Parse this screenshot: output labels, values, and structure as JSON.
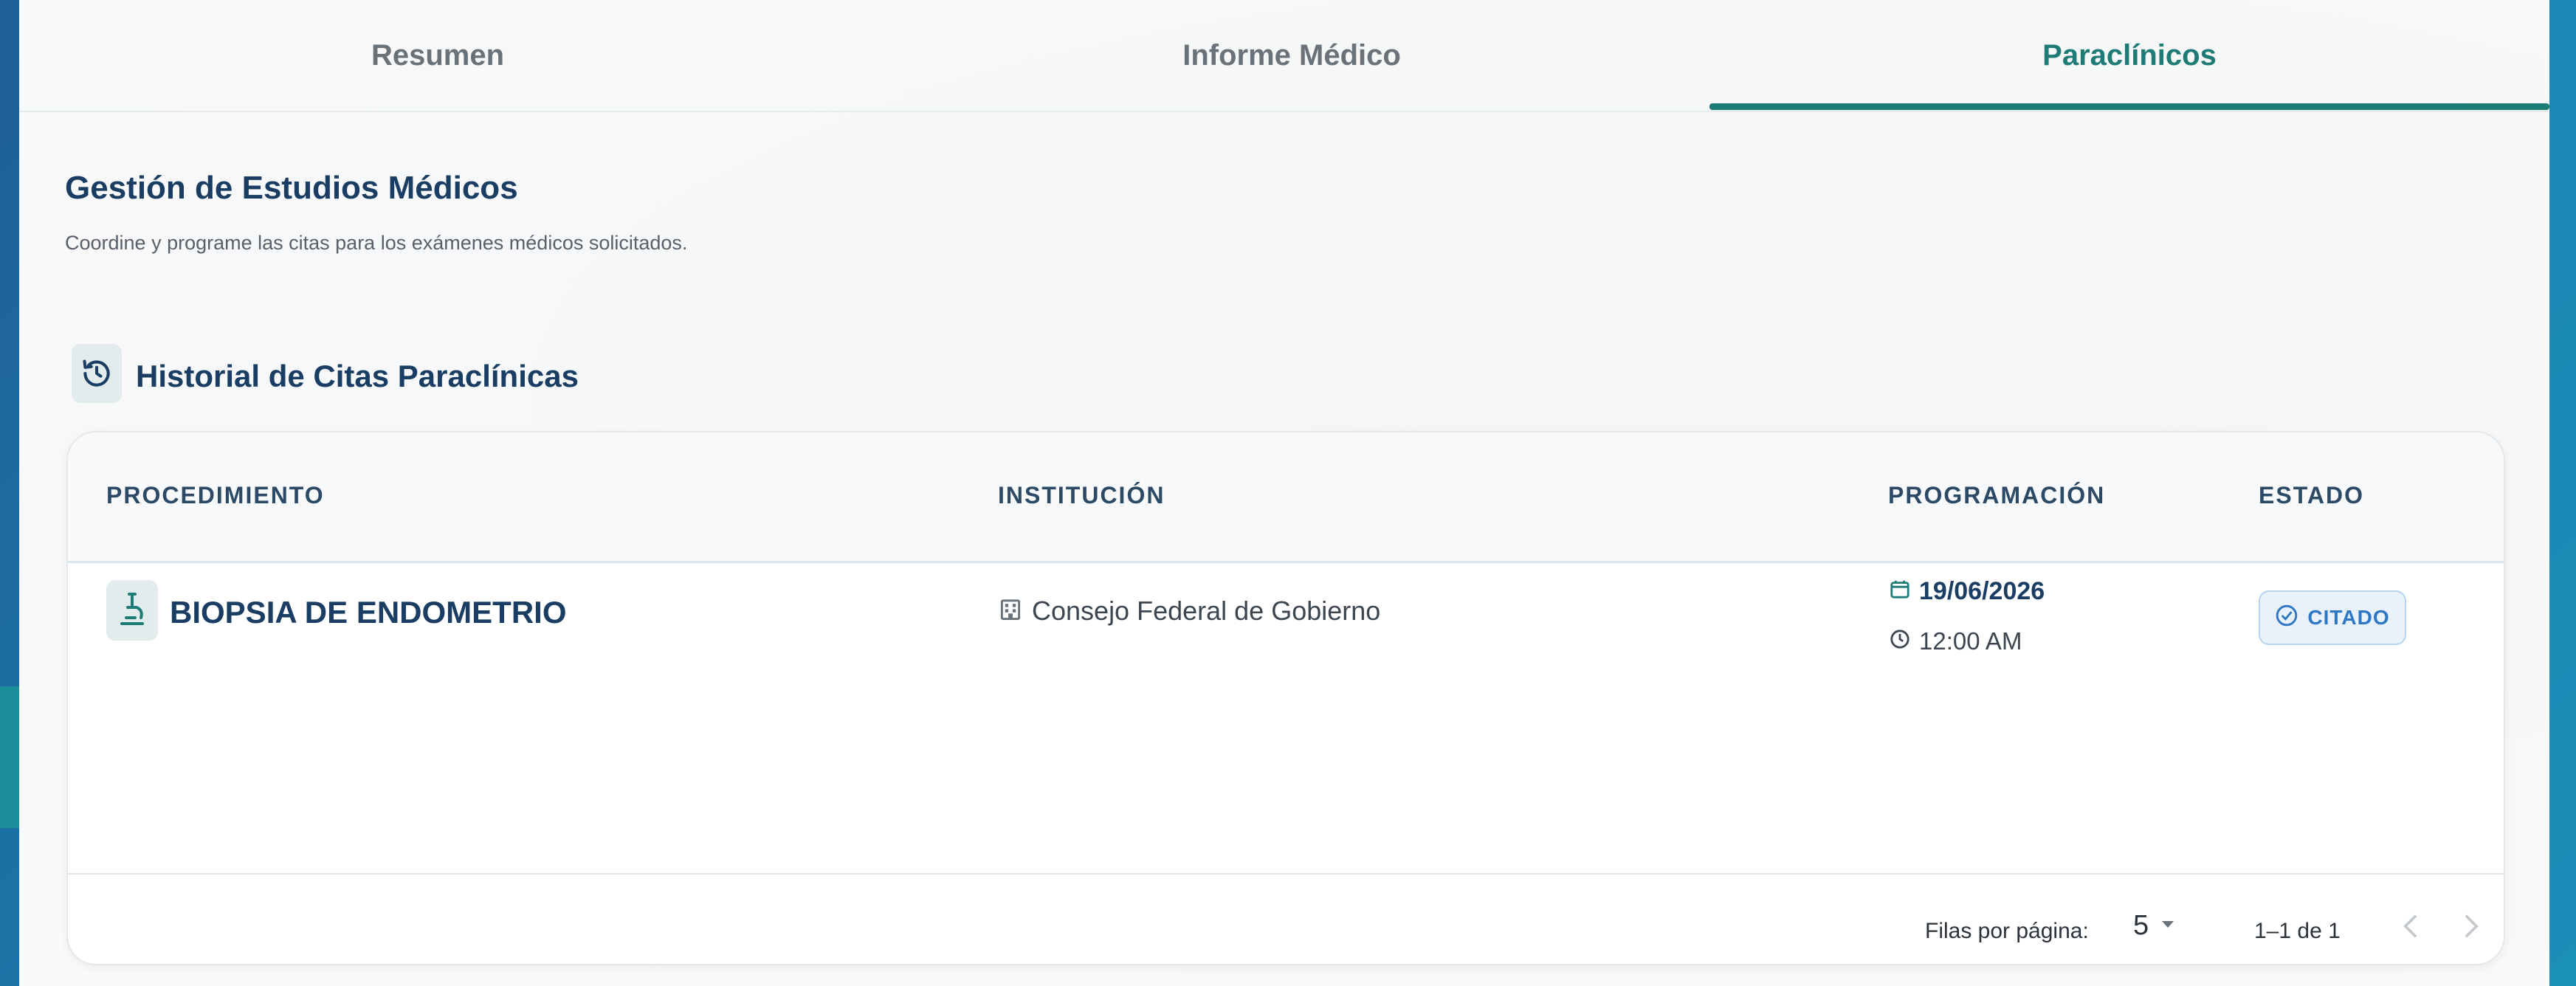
{
  "tabs": [
    {
      "label": "Resumen"
    },
    {
      "label": "Informe Médico"
    },
    {
      "label": "Paraclínicos"
    }
  ],
  "active_tab": "Paraclínicos",
  "section": {
    "title": "Gestión de Estudios Médicos",
    "subtitle": "Coordine y programe las citas para los exámenes médicos solicitados."
  },
  "history": {
    "title": "Historial de Citas Paraclínicas",
    "icon": "history-icon"
  },
  "table": {
    "headers": [
      "PROCEDIMIENTO",
      "INSTITUCIÓN",
      "PROGRAMACIÓN",
      "ESTADO"
    ],
    "rows": [
      {
        "procedure": "BIOPSIA DE ENDOMETRIO",
        "procedure_icon": "microscope-icon",
        "institution": "Consejo Federal de Gobierno",
        "institution_icon": "building-icon",
        "date": "19/06/2026",
        "time": "12:00 AM",
        "status": "CITADO"
      }
    ]
  },
  "pagination": {
    "rows_per_page_label": "Filas por página:",
    "rows_per_page": "5",
    "range": "1–1 de 1"
  },
  "colors": {
    "accent": "#1e7c76",
    "navy": "#1a3d63",
    "badge_blue": "#2e77c5"
  }
}
